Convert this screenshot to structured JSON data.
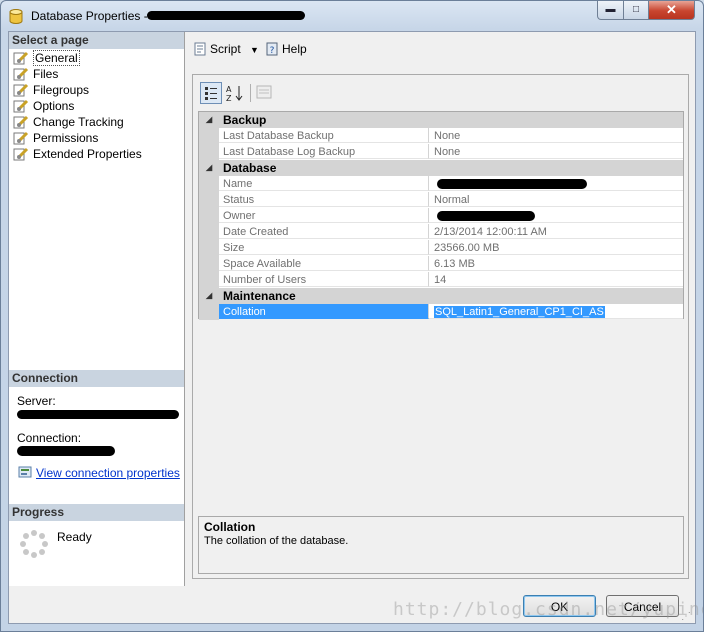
{
  "window": {
    "title": "Database Properties -",
    "caption_buttons": {
      "minimize": "▬",
      "maximize": "□",
      "close": "✕"
    }
  },
  "left_panel": {
    "select_page_header": "Select a page",
    "pages": [
      {
        "label": "General",
        "selected": true
      },
      {
        "label": "Files"
      },
      {
        "label": "Filegroups"
      },
      {
        "label": "Options"
      },
      {
        "label": "Change Tracking"
      },
      {
        "label": "Permissions"
      },
      {
        "label": "Extended Properties"
      }
    ],
    "connection_header": "Connection",
    "server_label": "Server:",
    "connection_label": "Connection:",
    "view_connection_link": "View connection properties",
    "progress_header": "Progress",
    "progress_status": "Ready"
  },
  "toolbar": {
    "script_label": "Script",
    "help_label": "Help"
  },
  "grid": {
    "categories": [
      {
        "name": "Backup",
        "rows": [
          {
            "name": "Last Database Backup",
            "value": "None"
          },
          {
            "name": "Last Database Log Backup",
            "value": "None"
          }
        ]
      },
      {
        "name": "Database",
        "rows": [
          {
            "name": "Name",
            "value": ""
          },
          {
            "name": "Status",
            "value": "Normal"
          },
          {
            "name": "Owner",
            "value": ""
          },
          {
            "name": "Date Created",
            "value": "2/13/2014 12:00:11 AM"
          },
          {
            "name": "Size",
            "value": "23566.00 MB"
          },
          {
            "name": "Space Available",
            "value": "6.13 MB"
          },
          {
            "name": "Number of Users",
            "value": "14"
          }
        ]
      },
      {
        "name": "Maintenance",
        "rows": [
          {
            "name": "Collation",
            "value": "SQL_Latin1_General_CP1_CI_AS",
            "selected": true
          }
        ]
      }
    ]
  },
  "description": {
    "title": "Collation",
    "text": "The collation of the database."
  },
  "buttons": {
    "ok": "OK",
    "cancel": "Cancel"
  },
  "watermark": "http://blog.csdn.net/yuping"
}
